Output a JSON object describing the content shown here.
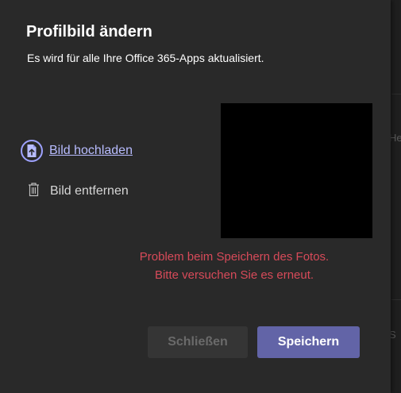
{
  "dialog": {
    "title": "Profilbild ändern",
    "subtitle": "Es wird für alle Ihre Office 365-Apps aktualisiert.",
    "upload_label": "Bild hochladen",
    "remove_label": "Bild entfernen",
    "error_line1": "Problem beim Speichern des Fotos.",
    "error_line2": "Bitte versuchen Sie es erneut.",
    "close_label": "Schließen",
    "save_label": "Speichern"
  },
  "background": {
    "peek_text_1": "He",
    "peek_text_2": "S"
  },
  "colors": {
    "accent": "#6264a7",
    "link": "#b8bcff",
    "error": "#d74a59",
    "dialog_bg": "#292929"
  },
  "icons": {
    "upload": "upload-image-icon",
    "remove": "trash-icon"
  }
}
